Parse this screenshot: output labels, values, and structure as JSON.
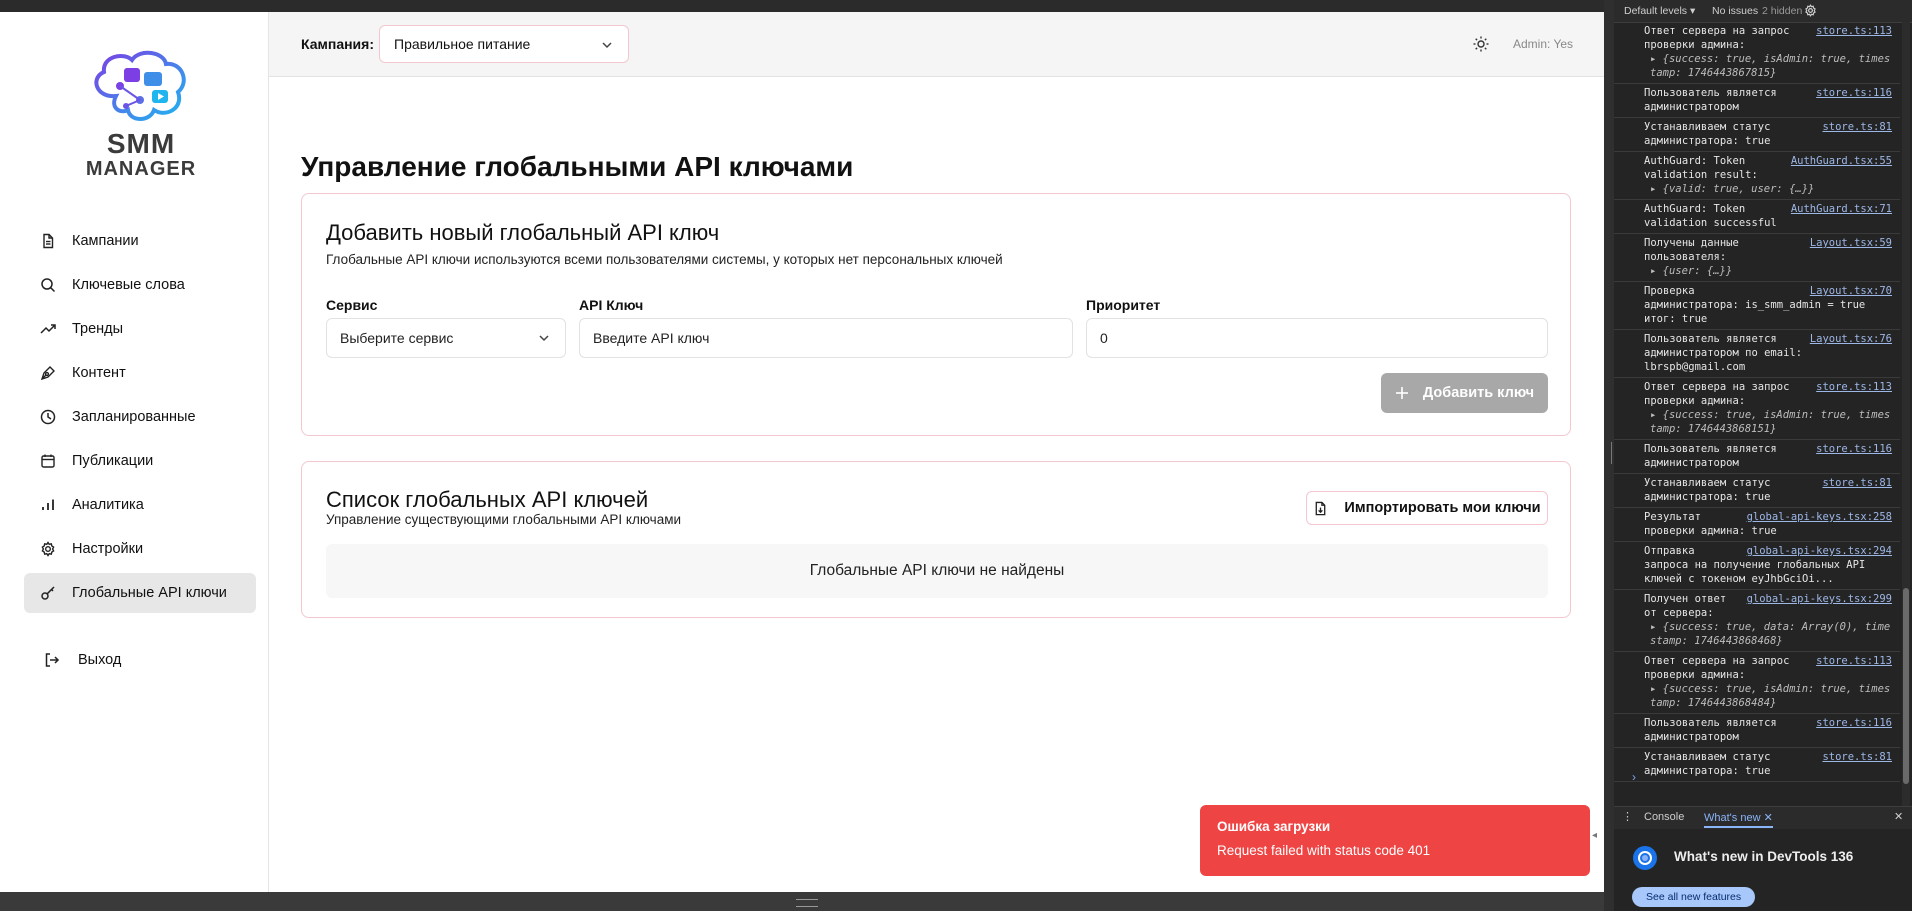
{
  "sidebar": {
    "logo": {
      "line1": "SMM",
      "line2": "MANAGER"
    },
    "items": [
      {
        "label": "Кампании",
        "icon": "document-icon"
      },
      {
        "label": "Ключевые слова",
        "icon": "search-icon"
      },
      {
        "label": "Тренды",
        "icon": "trending-up-icon"
      },
      {
        "label": "Контент",
        "icon": "pen-tool-icon"
      },
      {
        "label": "Запланированные",
        "icon": "clock-icon"
      },
      {
        "label": "Публикации",
        "icon": "calendar-icon"
      },
      {
        "label": "Аналитика",
        "icon": "bar-chart-icon"
      },
      {
        "label": "Настройки",
        "icon": "gear-icon"
      },
      {
        "label": "Глобальные API ключи",
        "icon": "key-icon",
        "active": true
      }
    ],
    "logout_label": "Выход"
  },
  "topbar": {
    "campaign_label": "Кампания:",
    "campaign_value": "Правильное питание",
    "admin_text": "Admin: Yes"
  },
  "page": {
    "title": "Управление глобальными API ключами"
  },
  "add_card": {
    "title": "Добавить новый глобальный API ключ",
    "description": "Глобальные API ключи используются всеми пользователями системы, у которых нет персональных ключей",
    "service_label": "Сервис",
    "service_placeholder": "Выберите сервис",
    "key_label": "API Ключ",
    "key_placeholder": "Введите API ключ",
    "priority_label": "Приоритет",
    "priority_value": "0",
    "add_button": "Добавить ключ"
  },
  "list_card": {
    "title": "Список глобальных API ключей",
    "description": "Управление существующими глобальными API ключами",
    "import_button": "Импортировать мои ключи",
    "empty_text": "Глобальные API ключи не найдены"
  },
  "toast": {
    "title": "Ошибка загрузки",
    "message": "Request failed with status code 401",
    "color": "#ef4444"
  },
  "devtools": {
    "toolbar": {
      "levels": "Default levels ▾",
      "issues": "No issues",
      "hidden": "2 hidden"
    },
    "entries": [
      {
        "text": "Ответ сервера на запрос\nпроверки админа:",
        "obj": "▸ {success: true, isAdmin: true, timestamp: 1746443867815}",
        "src": "store.ts:113"
      },
      {
        "text": "Пользователь является\nадминистратором",
        "src": "store.ts:116"
      },
      {
        "text": "Устанавливаем статус\nадминистратора: true",
        "src": "store.ts:81"
      },
      {
        "text": "AuthGuard: Token\nvalidation result:",
        "obj": "▸ {valid: true, user: {…}}",
        "src": "AuthGuard.tsx:55"
      },
      {
        "text": "AuthGuard: Token\nvalidation successful",
        "src": "AuthGuard.tsx:71"
      },
      {
        "text": "Получены данные\nпользователя:",
        "obj": "▸ {user: {…}}",
        "src": "Layout.tsx:59"
      },
      {
        "text": "Проверка\nадминистратора: is_smm_admin = true\nитог: true",
        "src": "Layout.tsx:70"
      },
      {
        "text": "Пользователь является\nадминистратором по email:\nlbrspb@gmail.com",
        "src": "Layout.tsx:76"
      },
      {
        "text": "Ответ сервера на запрос\nпроверки админа:",
        "obj": "▸ {success: true, isAdmin: true, timestamp: 1746443868151}",
        "src": "store.ts:113"
      },
      {
        "text": "Пользователь является\nадминистратором",
        "src": "store.ts:116"
      },
      {
        "text": "Устанавливаем статус\nадминистратора: true",
        "src": "store.ts:81"
      },
      {
        "text": "Результат\nпроверки админа: true",
        "src": "global-api-keys.tsx:258"
      },
      {
        "text": "Отправка\nзапроса на получение глобальных API\nключей с токеном eyJhbGciOi...",
        "src": "global-api-keys.tsx:294"
      },
      {
        "text": "Получен ответ\nот сервера:",
        "obj": "▸ {success: true, data: Array(0), timestamp: 1746443868468}",
        "src": "global-api-keys.tsx:299"
      },
      {
        "text": "Ответ сервера на запрос\nпроверки админа:",
        "obj": "▸ {success: true, isAdmin: true, timestamp: 1746443868484}",
        "src": "store.ts:113"
      },
      {
        "text": "Пользователь является\nадминистратором",
        "src": "store.ts:116"
      },
      {
        "text": "Устанавливаем статус\nадминистратора: true",
        "src": "store.ts:81"
      }
    ],
    "tabs": [
      {
        "label": "Console"
      },
      {
        "label": "What's new ✕",
        "active": true
      }
    ],
    "whatsnew_title": "What's new in DevTools 136",
    "see_all": "See all new features"
  }
}
